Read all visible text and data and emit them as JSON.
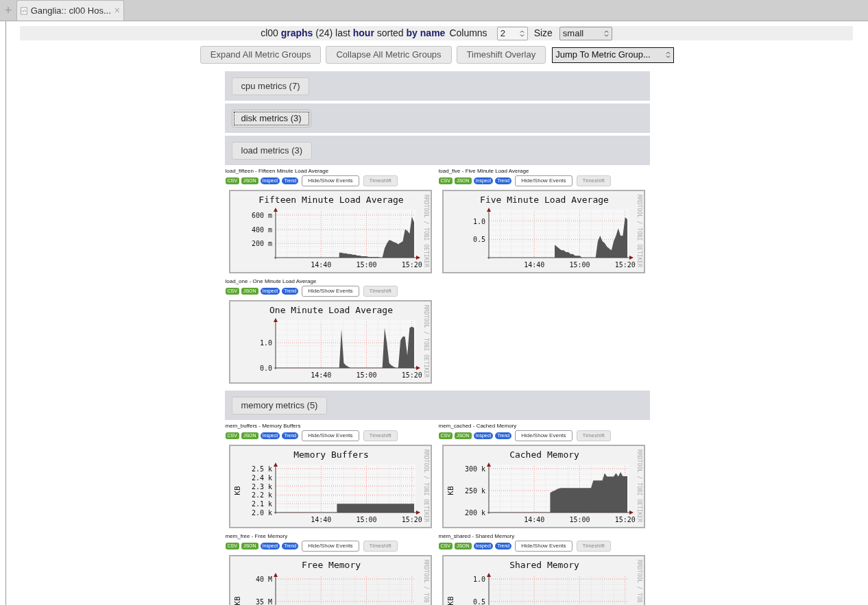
{
  "browser_tab": {
    "new_tab": "+",
    "title": "Ganglia:: cl00 Hos...",
    "close": "×"
  },
  "header": {
    "summary": "cl00 **graphs** (24) last **hour** sorted **by name**",
    "columns_label": "Columns",
    "columns_value": "2",
    "size_label": "Size",
    "size_value": "small"
  },
  "toolbar": [
    {
      "label": "Expand All Metric Groups",
      "kind": "button"
    },
    {
      "label": "Collapse All Metric Groups",
      "kind": "button"
    },
    {
      "label": "Timeshift Overlay",
      "kind": "button"
    },
    {
      "label": "Jump To Metric Group...",
      "kind": "select"
    }
  ],
  "groups": [
    {
      "label": "cpu metrics (7)",
      "focused": false
    },
    {
      "label": "disk metrics (3)",
      "focused": true
    },
    {
      "label": "load metrics (3)",
      "focused": false,
      "graphs": [
        {
          "caption": "load_fifteen - Fifteen Minute Load Average",
          "actions": [
            {
              "label": "CSV",
              "kind": "export"
            },
            {
              "label": "JSON",
              "kind": "export"
            },
            {
              "label": "Inspect",
              "kind": "view"
            },
            {
              "label": "Trend",
              "kind": "view"
            },
            {
              "label": "Hide/Show Events",
              "kind": "toggle",
              "disabled": false
            },
            {
              "label": "Timeshift",
              "kind": "toggle",
              "disabled": true
            }
          ],
          "credit": "RRDTOOL / TOBI OETIKER",
          "chart_data": {
            "type": "area",
            "title": "Fifteen Minute Load Average",
            "grid": true,
            "categories": [
              null,
              null,
              null,
              null,
              null,
              null,
              null,
              null,
              null,
              null,
              null,
              null,
              null,
              null,
              null,
              null,
              null,
              null,
              null,
              null,
              "14:40",
              null,
              null,
              null,
              null,
              null,
              null,
              null,
              null,
              null,
              null,
              null,
              null,
              null,
              null,
              null,
              null,
              null,
              null,
              null,
              "15:00",
              null,
              null,
              null,
              null,
              null,
              null,
              null,
              null,
              null,
              null,
              null,
              null,
              null,
              null,
              null,
              null,
              null,
              null,
              null,
              "15:20",
              null
            ],
            "series": [
              {
                "color": "#555555",
                "values": [
                  null,
                  null,
                  null,
                  null,
                  null,
                  null,
                  null,
                  null,
                  null,
                  null,
                  null,
                  null,
                  null,
                  null,
                  null,
                  null,
                  null,
                  null,
                  null,
                  null,
                  null,
                  null,
                  null,
                  null,
                  null,
                  null,
                  null,
                  null,
                  70,
                  70,
                  60,
                  60,
                  50,
                  50,
                  40,
                  40,
                  30,
                  30,
                  20,
                  20,
                  20,
                  10,
                  10,
                  10,
                  10,
                  10,
                  0,
                  0,
                  130,
                  200,
                  250,
                  240,
                  220,
                  210,
                  190,
                  210,
                  230,
                  400,
                  380,
                  340,
                  580,
                  500
                ]
              }
            ],
            "ylim": [
              0,
              620
            ],
            "yticks": [
              {
                "value": 200,
                "label": "200 m"
              },
              {
                "value": 400,
                "label": "400 m"
              },
              {
                "value": 600,
                "label": "600 m"
              }
            ]
          }
        },
        {
          "caption": "load_five - Five Minute Load Average",
          "actions": [
            {
              "label": "CSV",
              "kind": "export"
            },
            {
              "label": "JSON",
              "kind": "export"
            },
            {
              "label": "Inspect",
              "kind": "view"
            },
            {
              "label": "Trend",
              "kind": "view"
            },
            {
              "label": "Hide/Show Events",
              "kind": "toggle",
              "disabled": false
            },
            {
              "label": "Timeshift",
              "kind": "toggle",
              "disabled": true
            }
          ],
          "credit": "RRDTOOL / TOBI OETIKER",
          "chart_data": {
            "type": "area",
            "title": "Five Minute Load Average",
            "grid": true,
            "categories": [
              null,
              null,
              null,
              null,
              null,
              null,
              null,
              null,
              null,
              null,
              null,
              null,
              null,
              null,
              null,
              null,
              null,
              null,
              null,
              null,
              "14:40",
              null,
              null,
              null,
              null,
              null,
              null,
              null,
              null,
              null,
              null,
              null,
              null,
              null,
              null,
              null,
              null,
              null,
              null,
              null,
              "15:00",
              null,
              null,
              null,
              null,
              null,
              null,
              null,
              null,
              null,
              null,
              null,
              null,
              null,
              null,
              null,
              null,
              null,
              null,
              null,
              "15:20",
              null
            ],
            "series": [
              {
                "color": "#555555",
                "values": [
                  null,
                  null,
                  null,
                  null,
                  null,
                  null,
                  null,
                  null,
                  null,
                  null,
                  null,
                  null,
                  null,
                  null,
                  null,
                  null,
                  null,
                  null,
                  null,
                  null,
                  null,
                  null,
                  null,
                  null,
                  null,
                  null,
                  null,
                  null,
                  null,
                  0.35,
                  0.3,
                  0.25,
                  0.2,
                  0.2,
                  0.15,
                  0.15,
                  0.1,
                  0.1,
                  0.05,
                  0.05,
                  0.05,
                  0,
                  0,
                  0,
                  0,
                  0,
                  0,
                  0,
                  0.45,
                  0.6,
                  0.45,
                  0.4,
                  0.3,
                  0.25,
                  0.2,
                  0.45,
                  0.6,
                  0.8,
                  0.6,
                  0.6,
                  1.1,
                  1.05
                ]
              }
            ],
            "ylim": [
              0,
              1.2
            ],
            "yticks": [
              {
                "value": 0.5,
                "label": "0.5"
              },
              {
                "value": 1,
                "label": "1.0"
              }
            ]
          }
        },
        {
          "caption": "load_one - One Minute Load Average",
          "actions": [
            {
              "label": "CSV",
              "kind": "export"
            },
            {
              "label": "JSON",
              "kind": "export"
            },
            {
              "label": "Inspect",
              "kind": "view"
            },
            {
              "label": "Trend",
              "kind": "view"
            },
            {
              "label": "Hide/Show Events",
              "kind": "toggle",
              "disabled": false
            },
            {
              "label": "Timeshift",
              "kind": "toggle",
              "disabled": true
            }
          ],
          "credit": "RRDTOOL / TOBI OETIKER",
          "chart_data": {
            "type": "area",
            "title": "One Minute Load Average",
            "grid": true,
            "categories": [
              null,
              null,
              null,
              null,
              null,
              null,
              null,
              null,
              null,
              null,
              null,
              null,
              null,
              null,
              null,
              null,
              null,
              null,
              null,
              null,
              "14:40",
              null,
              null,
              null,
              null,
              null,
              null,
              null,
              null,
              null,
              null,
              null,
              null,
              null,
              null,
              null,
              null,
              null,
              null,
              null,
              "15:00",
              null,
              null,
              null,
              null,
              null,
              null,
              null,
              null,
              null,
              null,
              null,
              null,
              null,
              null,
              null,
              null,
              null,
              null,
              null,
              "15:20",
              null
            ],
            "series": [
              {
                "color": "#555555",
                "values": [
                  null,
                  null,
                  null,
                  null,
                  null,
                  null,
                  null,
                  null,
                  null,
                  null,
                  null,
                  null,
                  null,
                  null,
                  null,
                  null,
                  null,
                  null,
                  null,
                  null,
                  null,
                  null,
                  null,
                  null,
                  null,
                  null,
                  null,
                  null,
                  0,
                  1.55,
                  0.2,
                  0.1,
                  0.05,
                  0,
                  0,
                  0,
                  0,
                  0,
                  0,
                  0,
                  0,
                  0,
                  0,
                  0,
                  0,
                  0,
                  0,
                  0,
                  1.6,
                  1.0,
                  0.2,
                  0.1,
                  0.05,
                  0,
                  0,
                  1.1,
                  1.25,
                  1.25,
                  0.5,
                  1.6,
                  1.65,
                  1.6
                ]
              }
            ],
            "ylim": [
              0,
              1.75
            ],
            "yticks": [
              {
                "value": 0,
                "label": "0.0"
              },
              {
                "value": 1,
                "label": "1.0"
              }
            ]
          }
        }
      ]
    },
    {
      "label": "memory metrics (5)",
      "focused": false,
      "graphs": [
        {
          "caption": "mem_buffers - Memory Buffers",
          "actions": [
            {
              "label": "CSV",
              "kind": "export"
            },
            {
              "label": "JSON",
              "kind": "export"
            },
            {
              "label": "Inspect",
              "kind": "view"
            },
            {
              "label": "Trend",
              "kind": "view"
            },
            {
              "label": "Hide/Show Events",
              "kind": "toggle",
              "disabled": false
            },
            {
              "label": "Timeshift",
              "kind": "toggle",
              "disabled": true
            }
          ],
          "credit": "RRDTOOL / TOBI OETIKER",
          "chart_data": {
            "type": "area",
            "title": "Memory Buffers",
            "grid": true,
            "ylabel": "KB",
            "categories": [
              null,
              null,
              null,
              null,
              null,
              null,
              null,
              null,
              null,
              null,
              null,
              null,
              null,
              null,
              null,
              null,
              null,
              null,
              null,
              null,
              "14:40",
              null,
              null,
              null,
              null,
              null,
              null,
              null,
              null,
              null,
              null,
              null,
              null,
              null,
              null,
              null,
              null,
              null,
              null,
              null,
              "15:00",
              null,
              null,
              null,
              null,
              null,
              null,
              null,
              null,
              null,
              null,
              null,
              null,
              null,
              null,
              null,
              null,
              null,
              null,
              null,
              "15:20",
              null
            ],
            "series": [
              {
                "color": "#555555",
                "values": [
                  null,
                  null,
                  null,
                  null,
                  null,
                  null,
                  null,
                  null,
                  null,
                  null,
                  null,
                  null,
                  null,
                  null,
                  null,
                  null,
                  null,
                  null,
                  null,
                  null,
                  null,
                  null,
                  null,
                  null,
                  null,
                  null,
                  null,
                  2.1,
                  2.1,
                  2.1,
                  2.1,
                  2.1,
                  2.1,
                  2.1,
                  2.1,
                  2.1,
                  2.1,
                  2.1,
                  2.1,
                  2.1,
                  2.1,
                  2.1,
                  2.1,
                  2.1,
                  2.1,
                  2.1,
                  2.1,
                  2.1,
                  2.1,
                  2.1,
                  2.1,
                  2.1,
                  2.1,
                  2.1,
                  2.1,
                  2.1,
                  2.1,
                  2.1,
                  2.1,
                  2.1,
                  2.1,
                  2.1
                ]
              }
            ],
            "ylim": [
              2.0,
              2.5
            ],
            "yticks": [
              {
                "value": 2.0,
                "label": "2.0 k"
              },
              {
                "value": 2.1,
                "label": "2.1 k"
              },
              {
                "value": 2.2,
                "label": "2.2 k"
              },
              {
                "value": 2.3,
                "label": "2.3 k"
              },
              {
                "value": 2.4,
                "label": "2.4 k"
              },
              {
                "value": 2.5,
                "label": "2.5 k"
              }
            ]
          }
        },
        {
          "caption": "mem_cached - Cached Memory",
          "actions": [
            {
              "label": "CSV",
              "kind": "export"
            },
            {
              "label": "JSON",
              "kind": "export"
            },
            {
              "label": "Inspect",
              "kind": "view"
            },
            {
              "label": "Trend",
              "kind": "view"
            },
            {
              "label": "Hide/Show Events",
              "kind": "toggle",
              "disabled": false
            },
            {
              "label": "Timeshift",
              "kind": "toggle",
              "disabled": true
            }
          ],
          "credit": "RRDTOOL / TOBI OETIKER",
          "chart_data": {
            "type": "area",
            "title": "Cached Memory",
            "grid": true,
            "ylabel": "KB",
            "categories": [
              null,
              null,
              null,
              null,
              null,
              null,
              null,
              null,
              null,
              null,
              null,
              null,
              null,
              null,
              null,
              null,
              null,
              null,
              null,
              null,
              "14:40",
              null,
              null,
              null,
              null,
              null,
              null,
              null,
              null,
              null,
              null,
              null,
              null,
              null,
              null,
              null,
              null,
              null,
              null,
              null,
              "15:00",
              null,
              null,
              null,
              null,
              null,
              null,
              null,
              null,
              null,
              null,
              null,
              null,
              null,
              null,
              null,
              null,
              null,
              null,
              null,
              "15:20",
              null
            ],
            "series": [
              {
                "color": "#555555",
                "values": [
                  null,
                  null,
                  null,
                  null,
                  null,
                  null,
                  null,
                  null,
                  null,
                  null,
                  null,
                  null,
                  null,
                  null,
                  null,
                  null,
                  null,
                  null,
                  null,
                  null,
                  null,
                  null,
                  null,
                  null,
                  null,
                  null,
                  null,
                  245,
                  248,
                  250,
                  253,
                  255,
                  256,
                  256,
                  256,
                  256,
                  256,
                  256,
                  256,
                  256,
                  256,
                  256,
                  256,
                  256,
                  256,
                  256,
                  273,
                  273,
                  273,
                  273,
                  273,
                  290,
                  282,
                  282,
                  282,
                  282,
                  290,
                  282,
                  292,
                  283,
                  283,
                  283
                ]
              }
            ],
            "ylim": [
              200,
              300
            ],
            "yticks": [
              {
                "value": 200,
                "label": "200 k"
              },
              {
                "value": 250,
                "label": "250 k"
              },
              {
                "value": 300,
                "label": "300 k"
              }
            ]
          }
        },
        {
          "caption": "mem_free - Free Memory",
          "actions": [
            {
              "label": "CSV",
              "kind": "export"
            },
            {
              "label": "JSON",
              "kind": "export"
            },
            {
              "label": "Inspect",
              "kind": "view"
            },
            {
              "label": "Trend",
              "kind": "view"
            },
            {
              "label": "Hide/Show Events",
              "kind": "toggle",
              "disabled": false
            },
            {
              "label": "Timeshift",
              "kind": "toggle",
              "disabled": true
            }
          ],
          "credit": "RRDTOOL / TOB",
          "plot": {
            "title": "Free Memory",
            "ylabel": "KB",
            "tick_labels": [
              "40 M",
              "35 M"
            ]
          }
        },
        {
          "caption": "mem_shared - Shared Memory",
          "actions": [
            {
              "label": "CSV",
              "kind": "export"
            },
            {
              "label": "JSON",
              "kind": "export"
            },
            {
              "label": "Inspect",
              "kind": "view"
            },
            {
              "label": "Trend",
              "kind": "view"
            },
            {
              "label": "Hide/Show Events",
              "kind": "toggle",
              "disabled": false
            },
            {
              "label": "Timeshift",
              "kind": "toggle",
              "disabled": true
            }
          ],
          "credit": "RRDTOOL / TOB",
          "plot": {
            "title": "Shared Memory",
            "ylabel": "KB",
            "tick_labels": [
              "1.0",
              "0.5"
            ]
          }
        }
      ]
    }
  ]
}
